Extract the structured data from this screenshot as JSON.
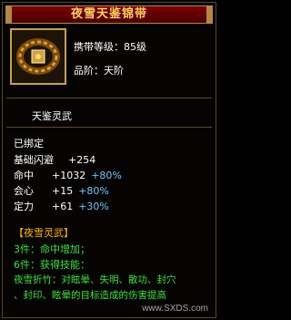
{
  "item": {
    "name": "夜雪天鉴锦带",
    "level_req": "携带等级：85级",
    "tier": "品阶：天阶",
    "style": "天鉴灵武"
  },
  "status": "已绑定",
  "stats": [
    {
      "label": "基础闪避",
      "value": "+254",
      "pct": ""
    },
    {
      "label": "命中",
      "value": "+1032",
      "pct": "+80%"
    },
    {
      "label": "会心",
      "value": "+15",
      "pct": "+80%"
    },
    {
      "label": "定力",
      "value": "+61",
      "pct": "+30%"
    }
  ],
  "set": {
    "name": "【夜雪灵武】",
    "bonus3": "3件：命中增加；",
    "bonus6": "6件：获得技能：",
    "skill_line1": "夜雪折竹：对眩晕、失明、散功、封穴",
    "skill_line2": "、封印、眩晕的目标造成的伤害提高"
  },
  "watermark": "www.SXDS.com",
  "colors": {
    "title": "#ffd060",
    "set_name": "#ffb400",
    "set_text": "#3ce13c",
    "percent": "#6cc8ff"
  },
  "icon": "belt-icon"
}
